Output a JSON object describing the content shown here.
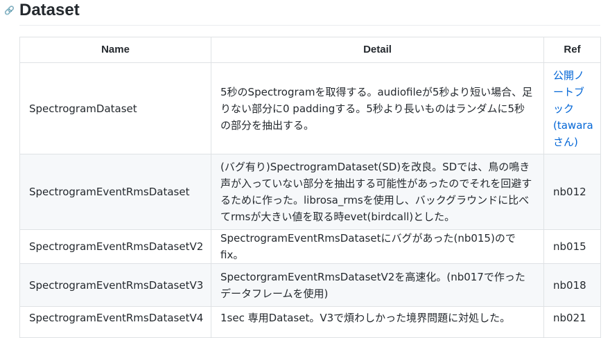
{
  "section": {
    "title": "Dataset"
  },
  "table": {
    "headers": {
      "name": "Name",
      "detail": "Detail",
      "ref": "Ref"
    },
    "rows": [
      {
        "name": "SpectrogramDataset",
        "detail": "5秒のSpectrogramを取得する。audiofileが5秒より短い場合、足りない部分に0 paddingする。5秒より長いものはランダムに5秒の部分を抽出する。",
        "ref": "公開ノートブック(tawaraさん)"
      },
      {
        "name": "SpectrogramEventRmsDataset",
        "detail": "(バグ有り)SpectrogramDataset(SD)を改良。SDでは、鳥の鳴き声が入っていない部分を抽出する可能性があったのでそれを回避するために作った。librosa_rmsを使用し、バックグラウンドに比べてrmsが大きい値を取る時evet(birdcall)とした。",
        "ref": "nb012"
      },
      {
        "name": "SpectrogramEventRmsDatasetV2",
        "detail": "SpectrogramEventRmsDatasetにバグがあった(nb015)のでfix。",
        "ref": "nb015"
      },
      {
        "name": "SpectrogramEventRmsDatasetV3",
        "detail": "SpectorgramEventRmsDatasetV2を高速化。(nb017で作ったデータフレームを使用)",
        "ref": "nb018"
      },
      {
        "name": "SpectrogramEventRmsDatasetV4",
        "detail": "1sec 専用Dataset。V3で煩わしかった境界問題に対処した。",
        "ref": "nb021"
      }
    ]
  }
}
